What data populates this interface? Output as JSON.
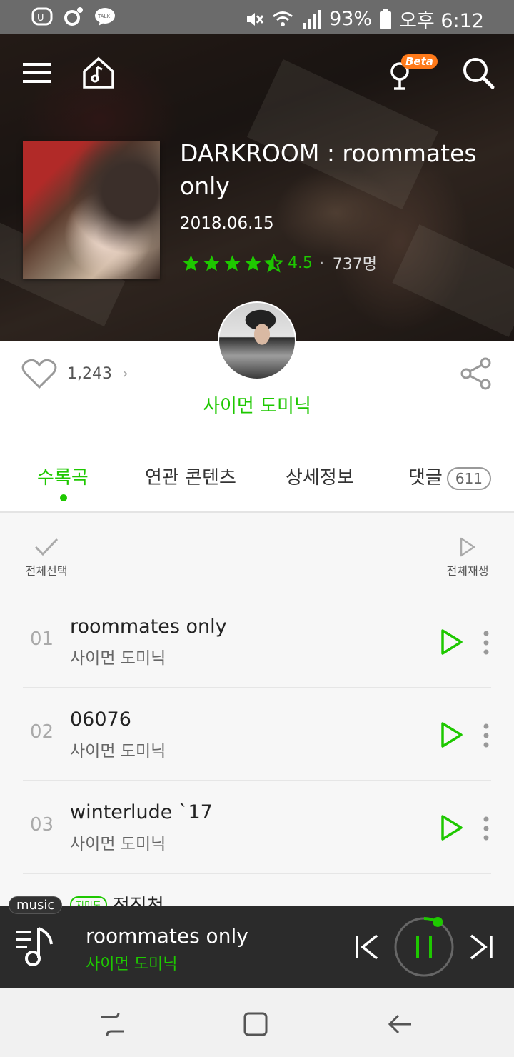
{
  "status_bar": {
    "battery": "93%",
    "time": "오후 6:12",
    "left_icons": [
      "talk-icon",
      "music-app-icon",
      "kakaotalk-icon"
    ],
    "right_icons": [
      "mute-icon",
      "wifi-icon",
      "signal-icon",
      "battery-icon"
    ]
  },
  "header": {
    "beta_label": "Beta"
  },
  "album": {
    "title": "DARKROOM : roommates only",
    "date": "2018.06.15",
    "rating": "4.5",
    "rating_count": "737명",
    "rating_stars": 4.5,
    "likes": "1,243",
    "artist": "사이먼 도미닉"
  },
  "tabs": [
    {
      "label": "수록곡",
      "active": true
    },
    {
      "label": "연관 콘텐츠"
    },
    {
      "label": "상세정보"
    },
    {
      "label": "댓글",
      "badge": "611"
    }
  ],
  "list_controls": {
    "select_all": "전체선택",
    "play_all": "전체재생"
  },
  "tracks": [
    {
      "no": "01",
      "title": "roommates only",
      "artist": "사이먼 도미닉"
    },
    {
      "no": "02",
      "title": "06076",
      "artist": "사이먼 도미닉"
    },
    {
      "no": "03",
      "title": "winterlude `17",
      "artist": "사이먼 도미닉"
    }
  ],
  "partial_row": {
    "badge": "지미도",
    "text": "정직천"
  },
  "mini_player": {
    "tag": "music",
    "title": "roommates only",
    "artist": "사이먼 도미닉",
    "progress": 0.08
  },
  "colors": {
    "accent": "#1ec800",
    "player_bg": "#2b2b2b"
  }
}
